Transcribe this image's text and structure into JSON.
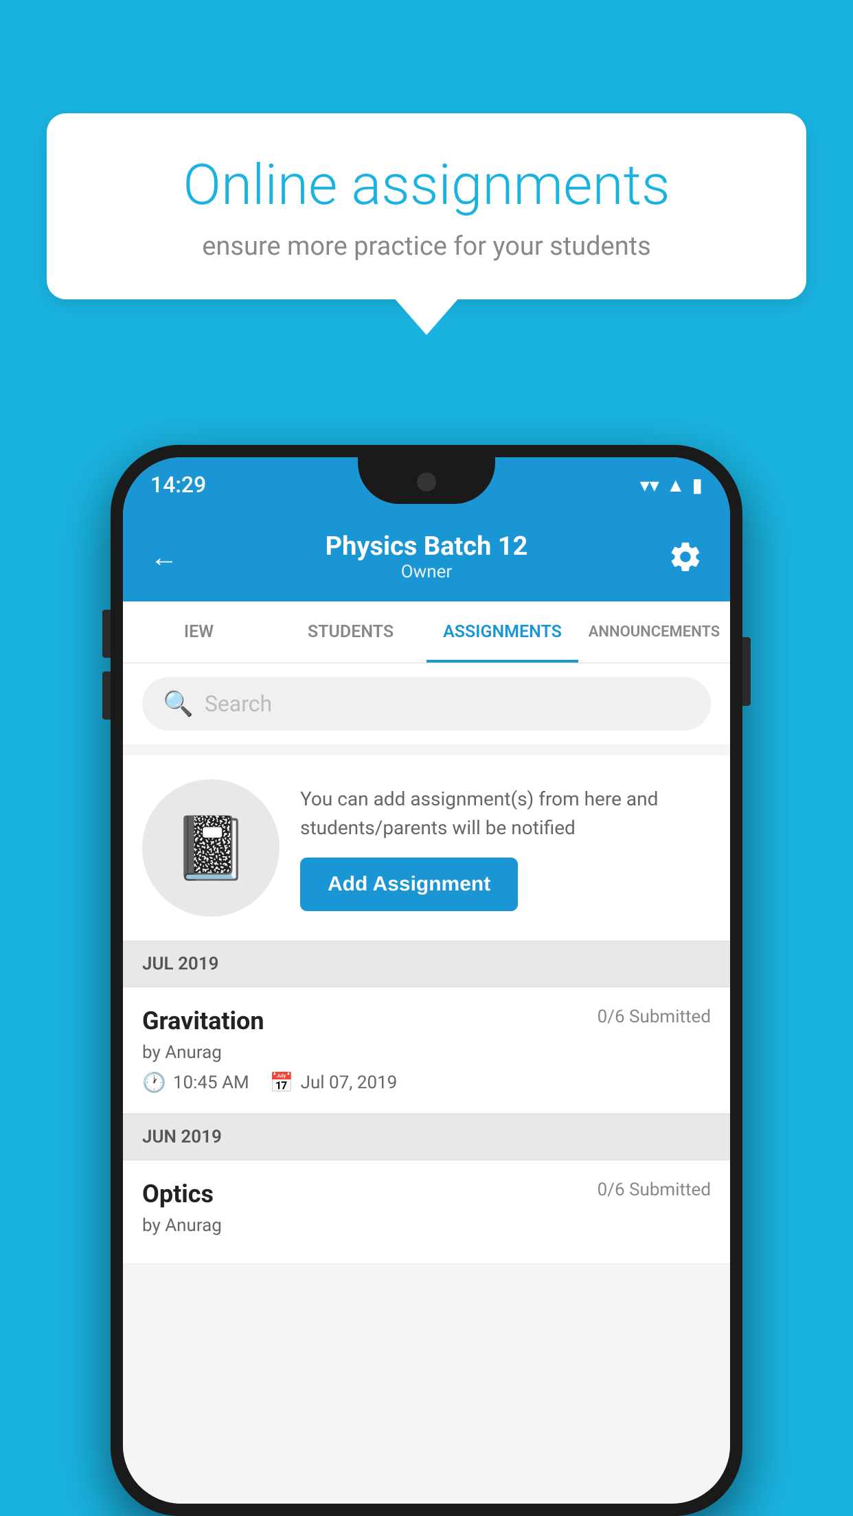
{
  "background_color": "#1ab3e0",
  "promo": {
    "title": "Online assignments",
    "subtitle": "ensure more practice for your students"
  },
  "status_bar": {
    "time": "14:29",
    "wifi_icon": "▲",
    "signal_icon": "▲",
    "battery_icon": "▮"
  },
  "header": {
    "title": "Physics Batch 12",
    "subtitle": "Owner",
    "back_label": "←",
    "settings_label": "⚙"
  },
  "tabs": [
    {
      "label": "IEW",
      "active": false
    },
    {
      "label": "STUDENTS",
      "active": false
    },
    {
      "label": "ASSIGNMENTS",
      "active": true
    },
    {
      "label": "ANNOUNCEMENTS",
      "active": false
    }
  ],
  "search": {
    "placeholder": "Search"
  },
  "assignment_promo": {
    "description": "You can add assignment(s) from here and students/parents will be notified",
    "button_label": "Add Assignment"
  },
  "sections": [
    {
      "label": "JUL 2019",
      "assignments": [
        {
          "title": "Gravitation",
          "submitted": "0/6 Submitted",
          "by": "by Anurag",
          "time": "10:45 AM",
          "date": "Jul 07, 2019"
        }
      ]
    },
    {
      "label": "JUN 2019",
      "assignments": [
        {
          "title": "Optics",
          "submitted": "0/6 Submitted",
          "by": "by Anurag",
          "time": "",
          "date": ""
        }
      ]
    }
  ]
}
